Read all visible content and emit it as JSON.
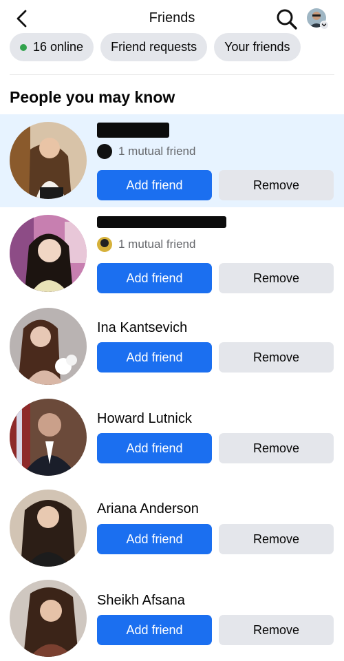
{
  "header": {
    "title": "Friends"
  },
  "chips": [
    {
      "label": "16 online",
      "status_color": "#31a24c"
    },
    {
      "label": "Friend requests"
    },
    {
      "label": "Your friends"
    }
  ],
  "section_title": "People you may know",
  "people": [
    {
      "name": "",
      "name_hidden": true,
      "mutual": "1 mutual friend",
      "add_label": "Add friend",
      "remove_label": "Remove"
    },
    {
      "name": "",
      "name_hidden": true,
      "mutual": "1 mutual friend",
      "add_label": "Add friend",
      "remove_label": "Remove"
    },
    {
      "name": "Ina Kantsevich",
      "add_label": "Add friend",
      "remove_label": "Remove"
    },
    {
      "name": "Howard Lutnick",
      "add_label": "Add friend",
      "remove_label": "Remove"
    },
    {
      "name": "Ariana Anderson",
      "add_label": "Add friend",
      "remove_label": "Remove"
    },
    {
      "name": "Sheikh Afsana",
      "add_label": "Add friend",
      "remove_label": "Remove"
    }
  ],
  "colors": {
    "primary_button": "#1b6ff0",
    "secondary_button": "#e4e6eb",
    "highlight_row": "#e7f3ff",
    "online_dot": "#31a24c"
  },
  "icons": [
    "back-arrow-icon",
    "search-icon",
    "profile-avatar",
    "chevron-down-icon"
  ]
}
